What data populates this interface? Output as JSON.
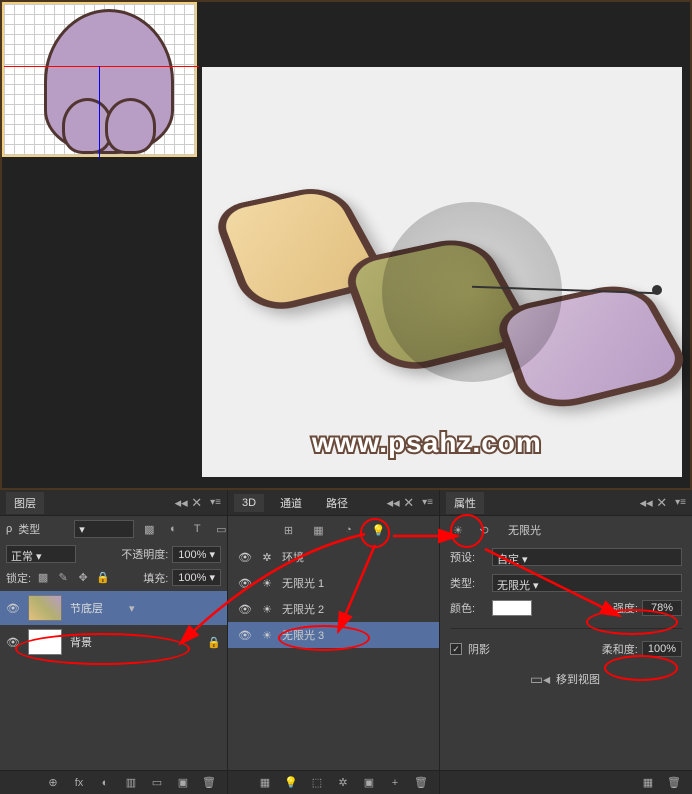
{
  "watermark": "www.psahz.com",
  "layers_panel": {
    "tab": "图层",
    "type_label": "类型",
    "blend_mode": "正常",
    "opacity_label": "不透明度:",
    "opacity_value": "100%",
    "lock_label": "锁定:",
    "fill_label": "填充:",
    "fill_value": "100%",
    "layers": [
      {
        "name": "节底层",
        "selected": true
      },
      {
        "name": "背景",
        "selected": false
      }
    ],
    "footer_icons": [
      "⊕",
      "fx",
      "◐",
      "▥",
      "▭",
      "▣",
      "🗑"
    ]
  },
  "d3_panel": {
    "tabs": [
      "3D",
      "通道",
      "路径"
    ],
    "items": [
      {
        "icon": "✲",
        "name": "环境"
      },
      {
        "icon": "☀",
        "name": "无限光 1"
      },
      {
        "icon": "☀",
        "name": "无限光 2"
      },
      {
        "icon": "☀",
        "name": "无限光 3",
        "selected": true
      }
    ],
    "footer_icons": [
      "▦",
      "💡",
      "⬚",
      "✲",
      "▣",
      "+",
      "🗑"
    ]
  },
  "props_panel": {
    "tab": "属性",
    "title": "无限光",
    "preset_label": "预设:",
    "preset_value": "自定",
    "type_label": "类型:",
    "type_value": "无限光",
    "color_label": "颜色:",
    "intensity_label": "强度:",
    "intensity_value": "78%",
    "shadow_label": "阴影",
    "softness_label": "柔和度:",
    "softness_value": "100%",
    "move_view": "移到视图"
  }
}
